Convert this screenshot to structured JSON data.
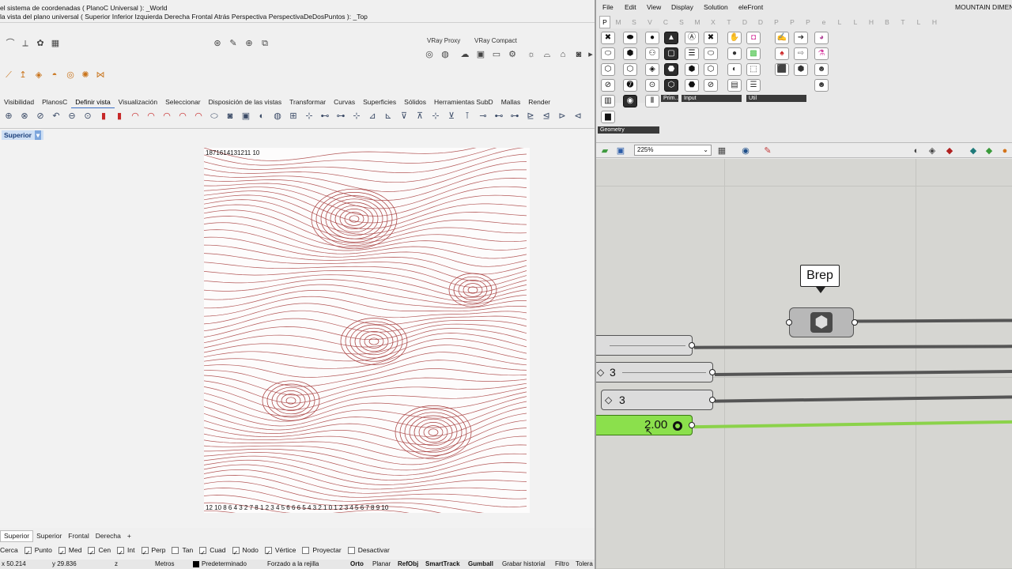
{
  "rhino": {
    "cmd1": "el sistema de coordenadas ( PlanoC  Universal ): _World",
    "cmd2": "la vista del plano universal ( Superior  Inferior  Izquierda  Derecha  Frontal  Atrás  Perspectiva  PerspectivaDeDosPuntos ): _Top",
    "vray_proxy": "VRay Proxy",
    "vray_compact": "VRay Compact",
    "tabs": [
      "Visibilidad",
      "PlanosC",
      "Definir vista",
      "Visualización",
      "Seleccionar",
      "Disposición de las vistas",
      "Transformar",
      "Curvas",
      "Superficies",
      "Sólidos",
      "Herramientas SubD",
      "Mallas",
      "Render"
    ],
    "viewport_label": "Superior",
    "viewport_tabs": [
      "Superior",
      "Superior",
      "Frontal",
      "Derecha",
      "+"
    ],
    "osnaps": [
      {
        "label": "Cerca",
        "checked": false
      },
      {
        "label": "Punto",
        "checked": true
      },
      {
        "label": "Med",
        "checked": true
      },
      {
        "label": "Cen",
        "checked": true
      },
      {
        "label": "Int",
        "checked": true
      },
      {
        "label": "Perp",
        "checked": true
      },
      {
        "label": "Tan",
        "checked": false
      },
      {
        "label": "Cuad",
        "checked": true
      },
      {
        "label": "Nodo",
        "checked": true
      },
      {
        "label": "Vértice",
        "checked": true
      },
      {
        "label": "Proyectar",
        "checked": false
      },
      {
        "label": "Desactivar",
        "checked": false
      }
    ],
    "status": {
      "x": "x 50.214",
      "y": "y 29.836",
      "z": "z",
      "units": "Metros",
      "layer": "Predeterminado",
      "grid": "Forzado a la rejilla",
      "ortho": "Orto",
      "planar": "Planar",
      "osnap": "RefObj",
      "smarttrack": "SmartTrack",
      "gumball": "Gumball",
      "history": "Grabar historial",
      "filter": "Filtro",
      "tol": "Tolera"
    },
    "contour_labels_top": "1871614131211 10",
    "contour_labels_bottom": "12 10 8 6 4 3 2 7 8 1 2 3 4 5 6 6 6 5 4 3 2 1 0 1 2 3 4 5 6 7 8 9 10",
    "contour_color": "#a63a3a"
  },
  "grasshopper": {
    "menu": [
      "File",
      "Edit",
      "View",
      "Display",
      "Solution",
      "eleFront"
    ],
    "title": "MOUNTAIN DIMEN",
    "tabs": [
      "P",
      "M",
      "S",
      "V",
      "C",
      "S",
      "M",
      "X",
      "T",
      "D",
      "D",
      "P",
      "P",
      "P",
      "e",
      "L",
      "L",
      "H",
      "B",
      "T",
      "L",
      "H"
    ],
    "groups": {
      "geometry": "Geometry",
      "prim": "Prim...",
      "input": "Input",
      "util": "Util"
    },
    "zoom": "225%",
    "tooltip": "Brep",
    "sliders": [
      {
        "value": "3"
      },
      {
        "value": "3"
      },
      {
        "value": "2.00"
      }
    ],
    "accent_green": "#8be04c"
  }
}
